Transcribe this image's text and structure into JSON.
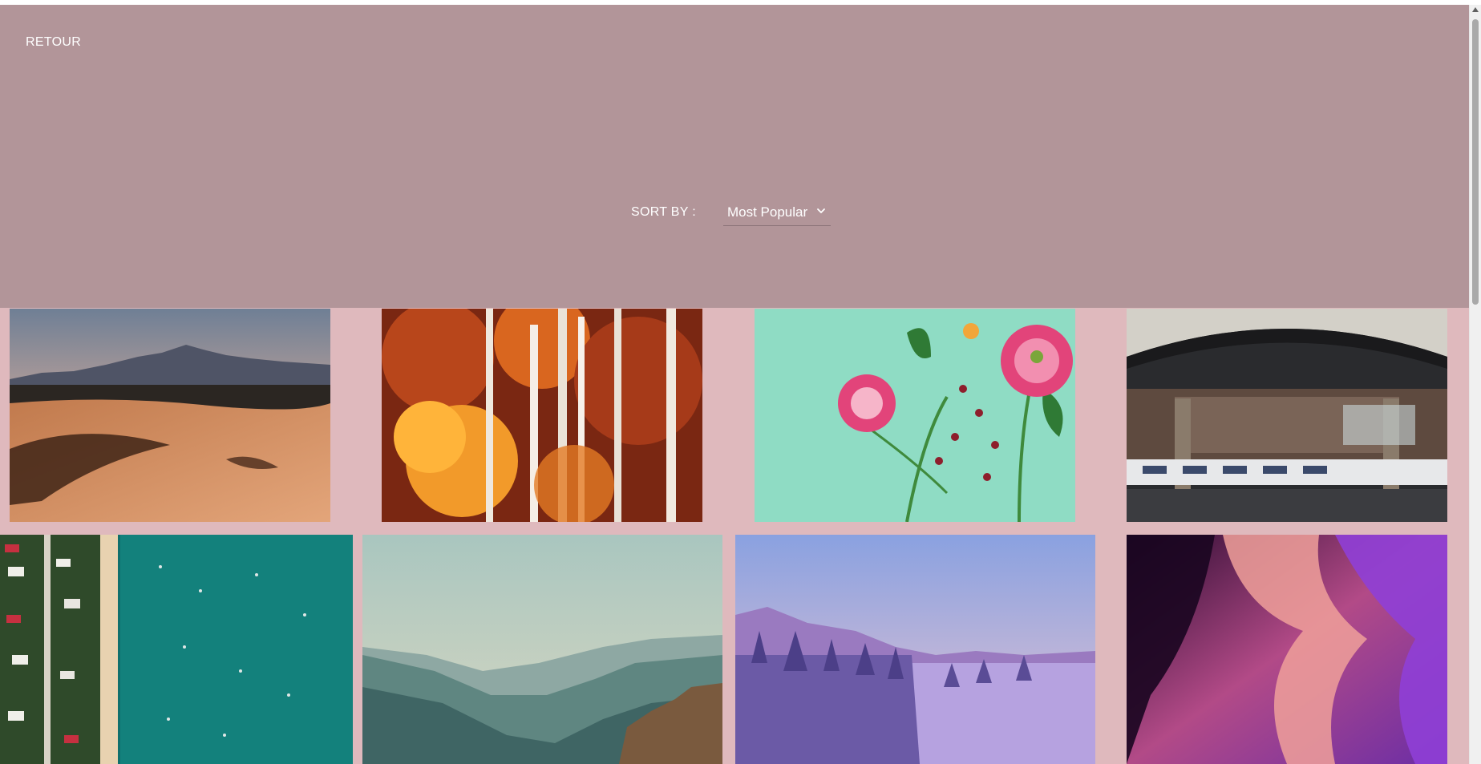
{
  "header": {
    "back_label": "RETOUR"
  },
  "sort": {
    "label": "SORT BY :",
    "selected": "Most Popular"
  },
  "gallery": {
    "items": [
      {
        "subject": "desert-dunes-mountains"
      },
      {
        "subject": "autumn-birch-forest"
      },
      {
        "subject": "pink-flowers-bouquet"
      },
      {
        "subject": "train-station-hall"
      },
      {
        "subject": "aerial-beach-coast"
      },
      {
        "subject": "misty-canyon-valley"
      },
      {
        "subject": "snowy-pine-landscape"
      },
      {
        "subject": "antelope-canyon-rock"
      }
    ]
  },
  "colors": {
    "hero_background": "#b29599",
    "page_background": "#dfb9bd",
    "text": "#ffffff"
  }
}
